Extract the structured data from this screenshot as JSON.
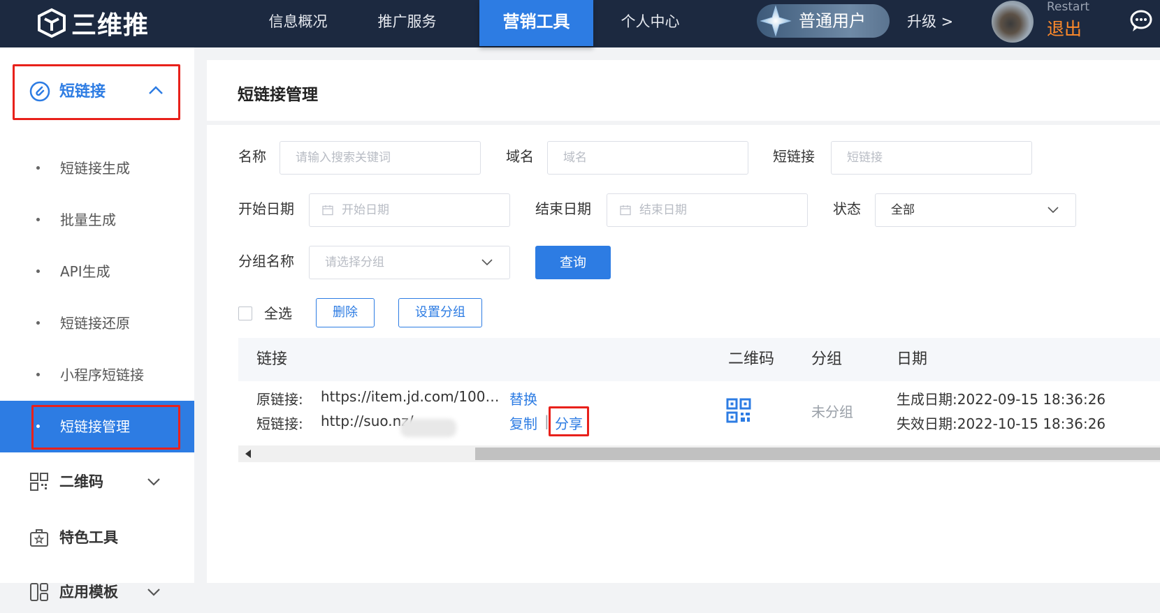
{
  "header": {
    "logo_text": "三维推",
    "nav": [
      "信息概况",
      "推广服务",
      "营销工具",
      "个人中心"
    ],
    "active_nav": "营销工具",
    "user_badge": "普通用户",
    "upgrade": "升级 >",
    "restart": "Restart",
    "logout": "退出"
  },
  "sidebar": {
    "section_title": "短链接",
    "items": [
      "短链接生成",
      "批量生成",
      "API生成",
      "短链接还原",
      "小程序短链接",
      "短链接管理"
    ],
    "active_item": "短链接管理",
    "groups": [
      "二维码",
      "特色工具",
      "应用模板"
    ]
  },
  "main": {
    "title": "短链接管理",
    "filters": {
      "name_label": "名称",
      "name_placeholder": "请输入搜索关键词",
      "domain_label": "域名",
      "domain_placeholder": "域名",
      "shortlink_label": "短链接",
      "shortlink_placeholder": "短链接",
      "start_label": "开始日期",
      "start_placeholder": "开始日期",
      "end_label": "结束日期",
      "end_placeholder": "结束日期",
      "status_label": "状态",
      "status_value": "全部",
      "group_label": "分组名称",
      "group_placeholder": "请选择分组",
      "search_button": "查询"
    },
    "actions": {
      "select_all": "全选",
      "delete": "删除",
      "set_group": "设置分组"
    },
    "table": {
      "headers": [
        "链接",
        "二维码",
        "分组",
        "日期"
      ],
      "rows": [
        {
          "orig_label": "原链接:",
          "orig_value": "https://item.jd.com/100…",
          "short_label": "短链接:",
          "short_value": "http://suo.nz/",
          "replace": "替换",
          "copy": "复制",
          "sep": "|",
          "share": "分享",
          "group": "未分组",
          "created": "生成日期:2022-09-15 18:36:26",
          "expires": "失效日期:2022-10-15 18:36:26"
        }
      ]
    }
  },
  "colors": {
    "header_bg": "#1c2940",
    "primary": "#2d7ce3",
    "highlight_border": "#e8211b",
    "logout": "#ff8a2a"
  }
}
